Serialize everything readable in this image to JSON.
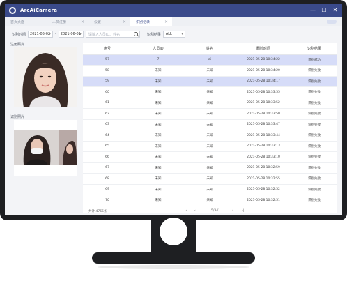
{
  "app": {
    "title": "ArcAiCamera"
  },
  "window": {
    "minimize": "—",
    "maximize": "☐",
    "close": "✕"
  },
  "tabs": [
    {
      "label": "首页页面",
      "active": false,
      "closable": false
    },
    {
      "label": "人员注册",
      "active": false,
      "closable": true
    },
    {
      "label": "设置",
      "active": false,
      "closable": true
    },
    {
      "label": "识别记录",
      "active": true,
      "closable": true
    }
  ],
  "tab_close_glyph": "×",
  "filters": {
    "time_label": "识别时间",
    "date_from": "2021-05-02",
    "date_to": "2021-06-01",
    "dash": "-",
    "search_placeholder": "请输入人员ID、姓名",
    "result_label": "识别结果",
    "result_value": "ALL"
  },
  "left": {
    "registered_photo_label": "注册照片",
    "captured_photo_label": "识别照片"
  },
  "table": {
    "columns": [
      "序号",
      "人员ID",
      "姓名",
      "刷脸时间",
      "识别结果"
    ],
    "rows": [
      {
        "cells": [
          "57",
          "7",
          "ai",
          "2021-05-28 10:34:22",
          "识别成功"
        ],
        "selected": true
      },
      {
        "cells": [
          "58",
          "未知",
          "未知",
          "2021-05-28 10:34:20",
          "识别失败"
        ],
        "selected": false
      },
      {
        "cells": [
          "59",
          "未知",
          "未知",
          "2021-05-28 10:34:17",
          "识别失败"
        ],
        "selected": true
      },
      {
        "cells": [
          "60",
          "未知",
          "未知",
          "2021-05-28 10:33:55",
          "识别失败"
        ],
        "selected": false
      },
      {
        "cells": [
          "61",
          "未知",
          "未知",
          "2021-05-28 10:33:52",
          "识别失败"
        ],
        "selected": false
      },
      {
        "cells": [
          "62",
          "未知",
          "未知",
          "2021-05-28 10:33:50",
          "识别失败"
        ],
        "selected": false
      },
      {
        "cells": [
          "63",
          "未知",
          "未知",
          "2021-05-28 10:33:47",
          "识别失败"
        ],
        "selected": false
      },
      {
        "cells": [
          "64",
          "未知",
          "未知",
          "2021-05-28 10:33:44",
          "识别失败"
        ],
        "selected": false
      },
      {
        "cells": [
          "65",
          "未知",
          "未知",
          "2021-05-28 10:33:13",
          "识别失败"
        ],
        "selected": false
      },
      {
        "cells": [
          "66",
          "未知",
          "未知",
          "2021-05-28 10:33:10",
          "识别失败"
        ],
        "selected": false
      },
      {
        "cells": [
          "67",
          "未知",
          "未知",
          "2021-05-28 10:32:59",
          "识别失败"
        ],
        "selected": false
      },
      {
        "cells": [
          "68",
          "未知",
          "未知",
          "2021-05-28 10:32:55",
          "识别失败"
        ],
        "selected": false
      },
      {
        "cells": [
          "69",
          "未知",
          "未知",
          "2021-05-28 10:32:52",
          "识别失败"
        ],
        "selected": false
      },
      {
        "cells": [
          "70",
          "未知",
          "未知",
          "2021-05-28 10:32:51",
          "识别失败"
        ],
        "selected": false
      }
    ]
  },
  "pager": {
    "total": "共计:4765条",
    "first": "|‹",
    "prev": "‹",
    "page": "5/341",
    "next": "›",
    "last": "›|"
  },
  "colors": {
    "accent": "#3a4a8a",
    "selected_row": "#d6dcf8",
    "bezel": "#1e1f22"
  }
}
